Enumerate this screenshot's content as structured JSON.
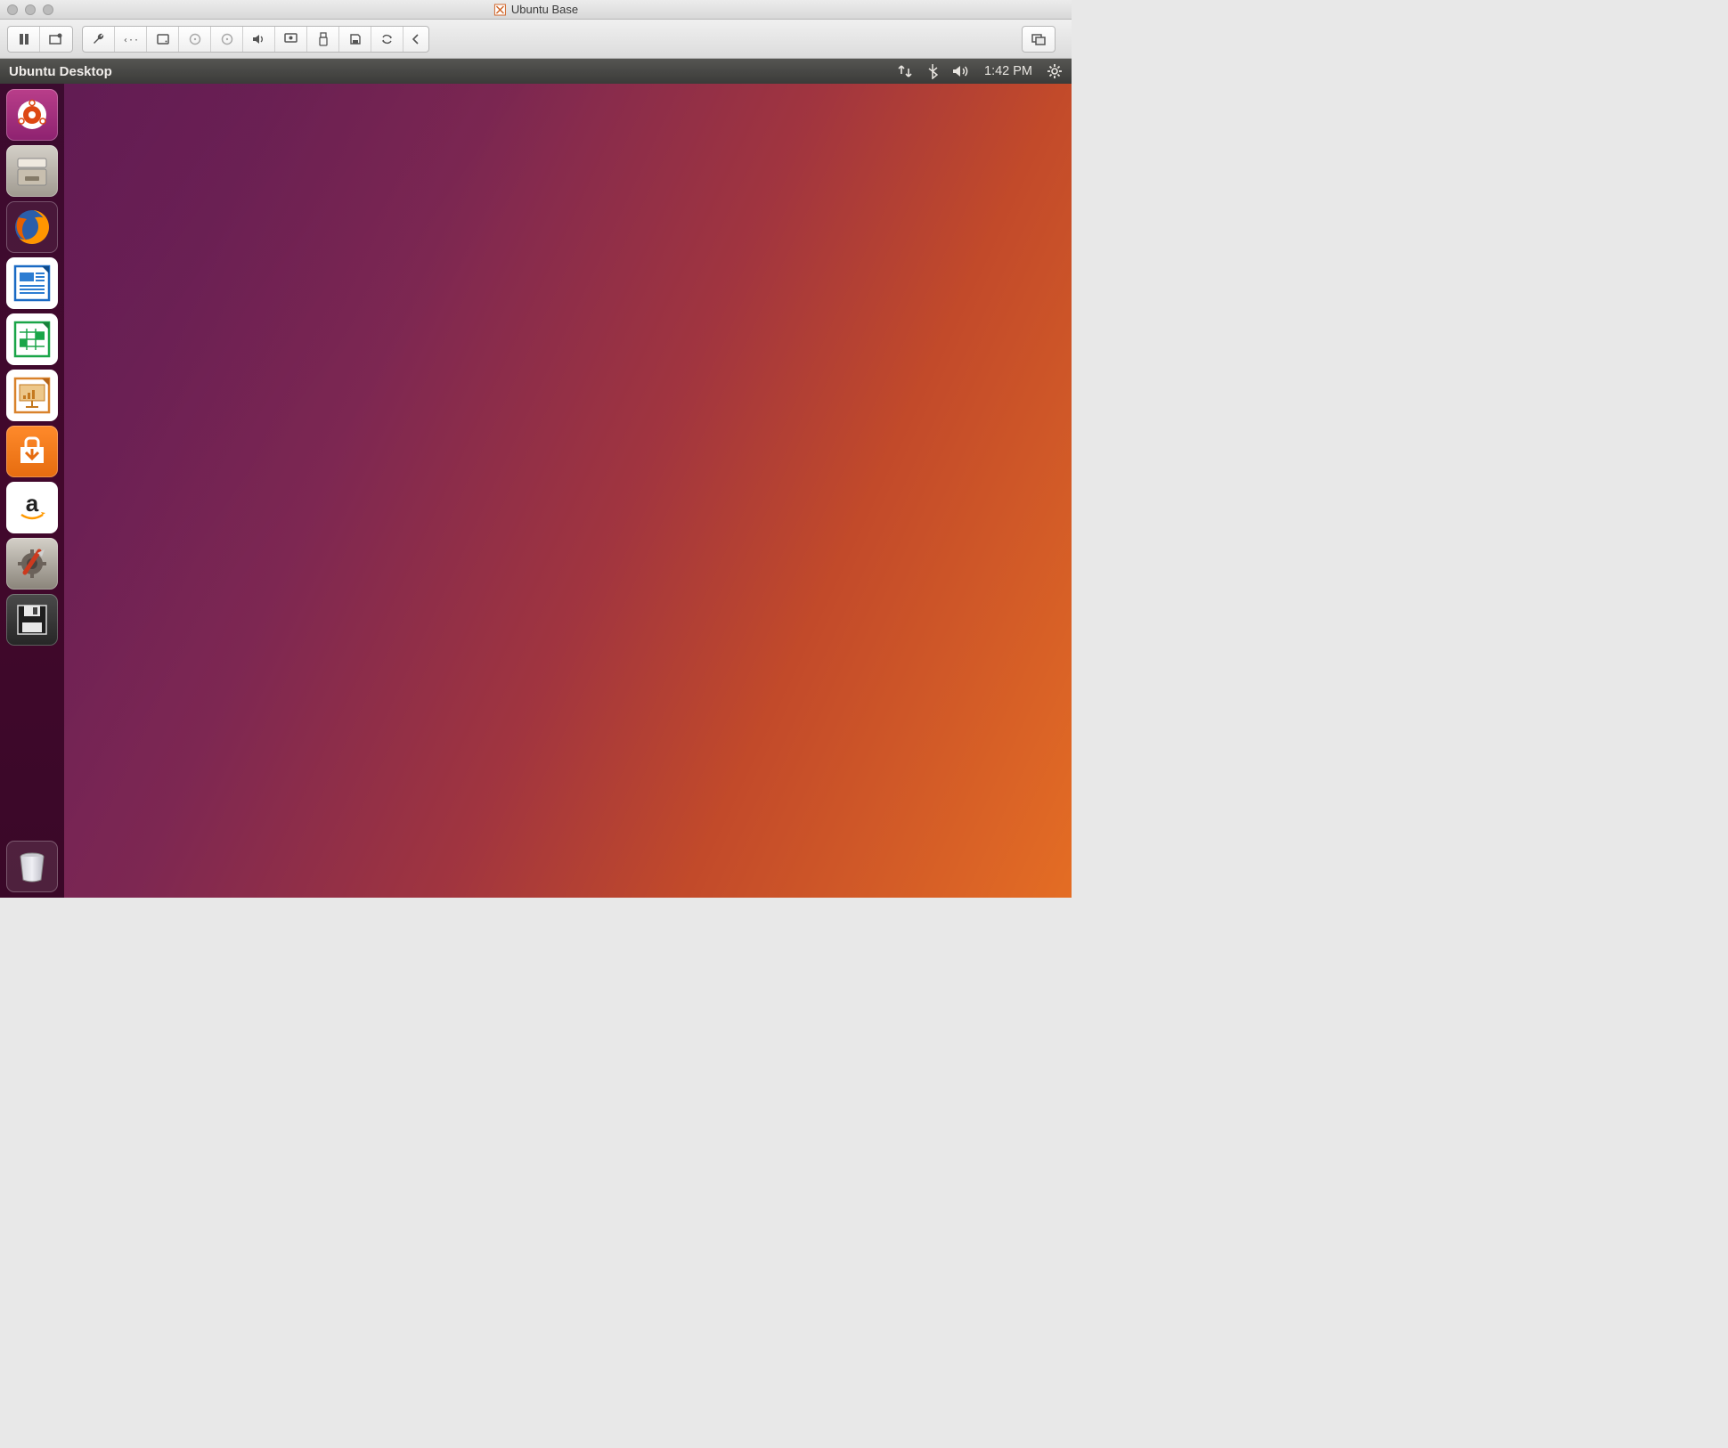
{
  "host": {
    "window_title": "Ubuntu Base",
    "toolbar_icons": [
      "pause-icon",
      "snapshot-icon",
      "wrench-icon",
      "network-icon",
      "harddrive-icon",
      "cd1-icon",
      "cd2-icon",
      "sound-icon",
      "display-icon",
      "usb-icon",
      "floppy-icon",
      "sync-icon",
      "collapse-left-icon"
    ],
    "fullscreen_icon": "fullscreen-icon"
  },
  "ubuntu": {
    "panel_title": "Ubuntu Desktop",
    "indicators": {
      "network": "network-indicator-icon",
      "bluetooth": "bluetooth-indicator-icon",
      "sound": "sound-indicator-icon",
      "time": "1:42 PM",
      "settings": "gear-indicator-icon"
    },
    "launcher": [
      {
        "name": "dash-icon",
        "label": "Dash"
      },
      {
        "name": "files-icon",
        "label": "Files"
      },
      {
        "name": "firefox-icon",
        "label": "Firefox"
      },
      {
        "name": "writer-icon",
        "label": "LibreOffice Writer"
      },
      {
        "name": "calc-icon",
        "label": "LibreOffice Calc"
      },
      {
        "name": "impress-icon",
        "label": "LibreOffice Impress"
      },
      {
        "name": "software-icon",
        "label": "Ubuntu Software"
      },
      {
        "name": "amazon-icon",
        "label": "Amazon"
      },
      {
        "name": "settings-app-icon",
        "label": "System Settings"
      },
      {
        "name": "disk-icon",
        "label": "Disk"
      }
    ],
    "trash": {
      "name": "trash-icon",
      "label": "Trash"
    }
  }
}
